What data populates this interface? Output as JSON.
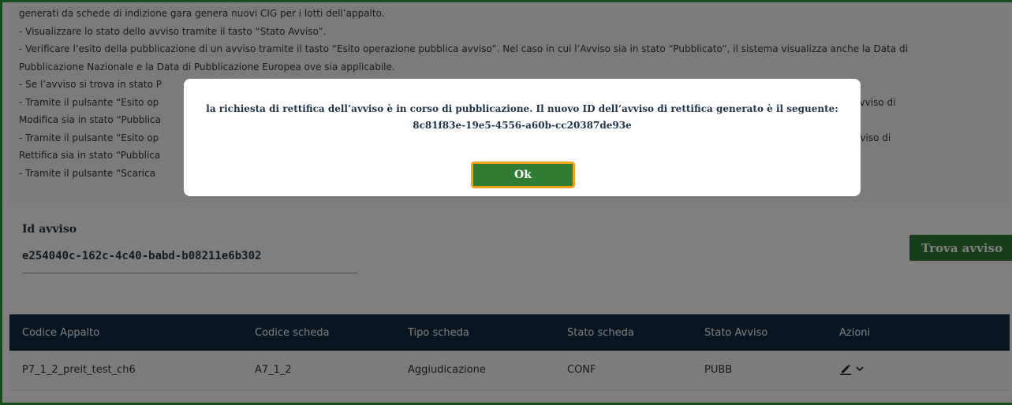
{
  "info": {
    "lines": [
      "generati da schede di indizione gara genera nuovi CIG per i lotti dell’appalto.",
      "- Visualizzare lo stato dello avviso tramite il tasto “Stato Avviso”.",
      "- Verificare l’esito della pubblicazione di un avviso tramite il tasto “Esito operazione pubblica avviso”. Nel caso in cui l’Avviso sia in stato “Pubblicato”, il sistema visualizza anche la Data di",
      "Pubblicazione Nazionale e la Data di Pubblicazione Europea ove sia applicabile.",
      "- Se l’avviso si trova in stato P",
      "- Tramite il pulsante “Esito op                                                                                                                                                                                                                       so in cui l’Avviso di",
      "Modifica sia in stato “Pubblica",
      "- Tramite il pulsante “Esito op                                                                                                                                                                                                                       o in cui l’Avviso di",
      "Rettifica sia in stato “Pubblica",
      "- Tramite il pulsante “Scarica"
    ]
  },
  "search": {
    "id_label": "Id avviso",
    "id_value": "e254040c-162c-4c40-babd-b08211e6b302",
    "find_button": "Trova avviso"
  },
  "table": {
    "headers": [
      "Codice Appalto",
      "Codice scheda",
      "Tipo scheda",
      "Stato scheda",
      "Stato Avviso",
      "Azioni"
    ],
    "rows": [
      [
        "P7_1_2_preit_test_ch6",
        "A7_1_2",
        "Aggiudicazione",
        "CONF",
        "PUBB"
      ]
    ],
    "action_icons": [
      "pencil-icon",
      "chevron-down-icon"
    ]
  },
  "modal": {
    "message_line1": "la richiesta di rettifica dell’avviso è in corso di pubblicazione. Il nuovo ID dell’avviso di rettifica generato è il seguente:",
    "message_line2": "8c81f83e-19e5-4556-a60b-cc20387de93e",
    "ok_button": "Ok"
  },
  "colors": {
    "accent_green": "#2f7d32",
    "table_header": "#0f2a40",
    "focus_orange": "#f4a31a",
    "frame_green": "#2f9a3c"
  }
}
